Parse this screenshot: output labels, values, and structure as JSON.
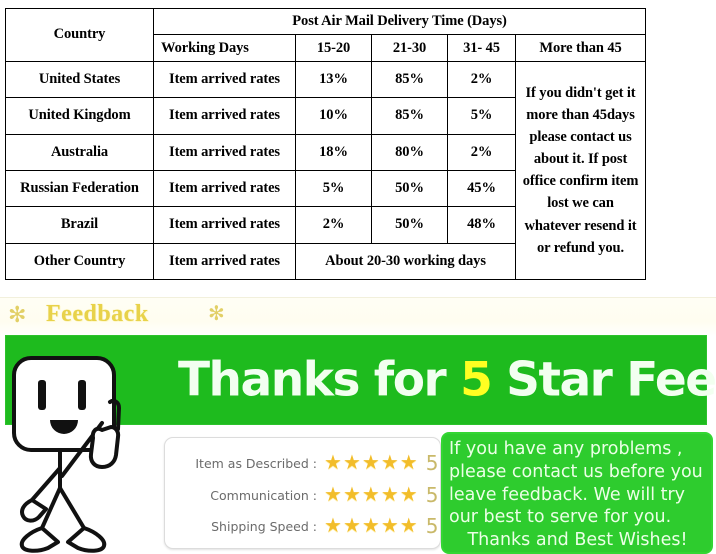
{
  "shipping_table": {
    "header": {
      "country_label": "Country",
      "group_label": "Post Air Mail Delivery Time (Days)",
      "working_days_label": "Working Days",
      "range_a": "15-20",
      "range_b": "21-30",
      "range_c": "31- 45",
      "more_than_label": "More than 45"
    },
    "note": "If you didn't get it more than 45days please contact us about it. If post office confirm item lost we can whatever resend it or refund you.",
    "rows": [
      {
        "country": "United States",
        "working": "Item arrived rates",
        "a": "13%",
        "b": "85%",
        "c": "2%"
      },
      {
        "country": "United Kingdom",
        "working": "Item arrived rates",
        "a": "10%",
        "b": "85%",
        "c": "5%"
      },
      {
        "country": "Australia",
        "working": "Item arrived rates",
        "a": "18%",
        "b": "80%",
        "c": "2%"
      },
      {
        "country": "Russian Federation",
        "working": "Item arrived rates",
        "a": "5%",
        "b": "50%",
        "c": "45%"
      },
      {
        "country": "Brazil",
        "working": "Item arrived rates",
        "a": "2%",
        "b": "50%",
        "c": "48%"
      }
    ],
    "other_row": {
      "country": "Other Country",
      "working": "Item arrived rates",
      "span_text": "About 20-30 working days"
    }
  },
  "feedback_header": {
    "title": "Feedback",
    "sparkle_left": "sparkle-icon",
    "sparkle_right": "sparkle-icon",
    "gold_color": "#e8d24a"
  },
  "banner": {
    "text_before": "Thanks for ",
    "highlight_number": "5",
    "text_after": " Star Feedback",
    "exclaim": "!",
    "bg_color": "#1ebb1e",
    "text_color": "#f2fff0",
    "highlight_color": "#ffff22"
  },
  "mascot": {
    "name": "thumbs-up-mascot"
  },
  "ratings": {
    "rows": [
      {
        "label": "Item as Described :",
        "stars": 5,
        "score": "5"
      },
      {
        "label": "Communication :",
        "stars": 5,
        "score": "5"
      },
      {
        "label": "Shipping Speed :",
        "stars": 5,
        "score": "5"
      }
    ],
    "star_glyph": "★",
    "star_color": "#f2bd2a"
  },
  "message_box": {
    "line1": "If you have any problems ,",
    "line2": "please contact us before you",
    "line3": "leave feedback. We will try",
    "line4": "our best to serve for you.",
    "line5": "Thanks and Best Wishes!",
    "bg_color": "#2ecc2e"
  }
}
